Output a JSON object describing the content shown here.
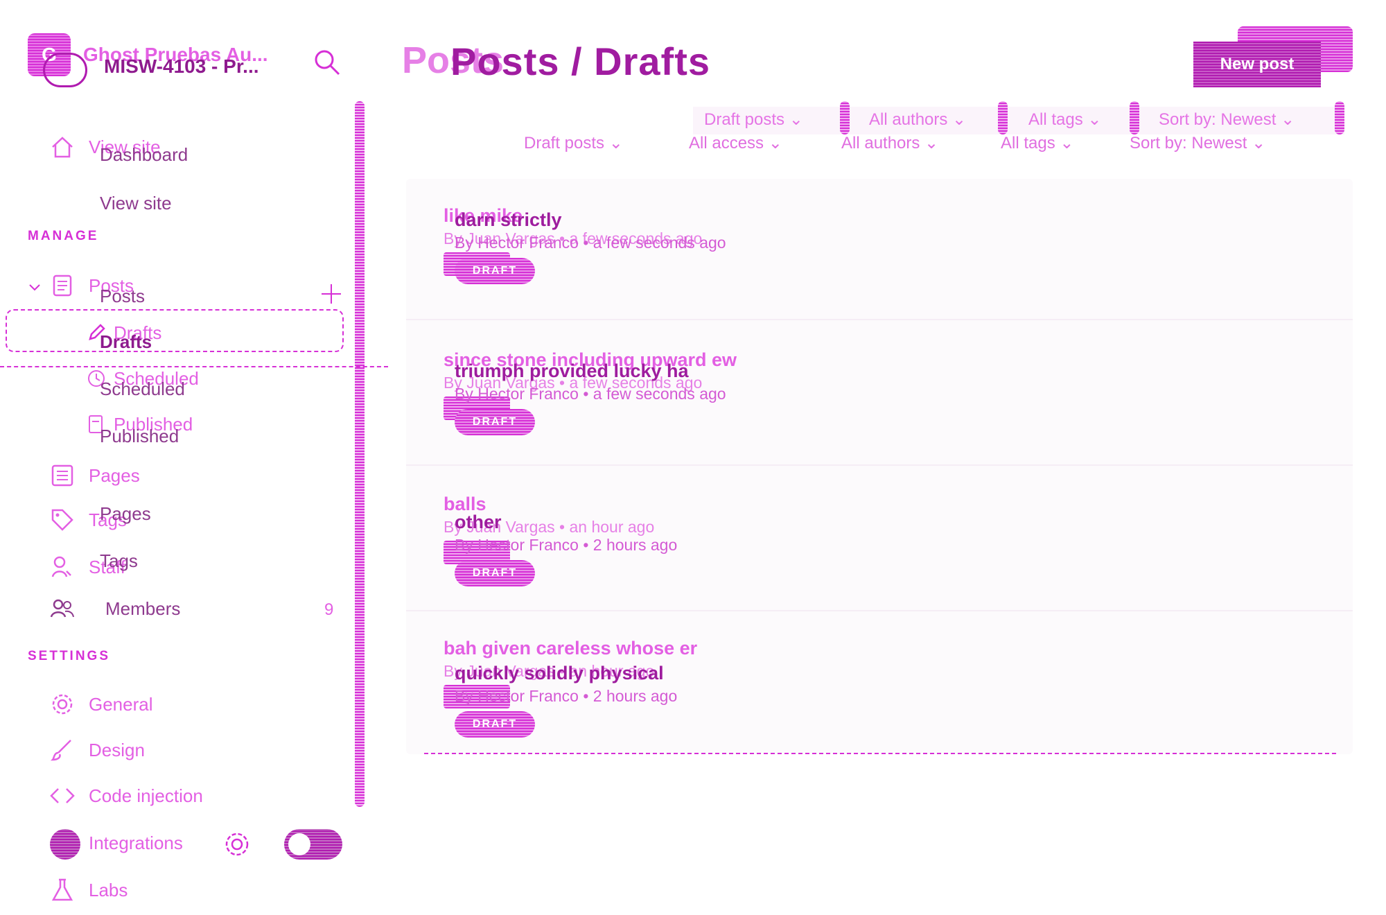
{
  "app": {
    "logo_text": "G",
    "title": "Ghost Pruebas Au...",
    "title2": "MISW-4103 - Pr..."
  },
  "sidebar": {
    "items": [
      {
        "label": "View site"
      },
      {
        "label": "Posts"
      },
      {
        "label": "Drafts"
      },
      {
        "label": "Scheduled"
      },
      {
        "label": "Published"
      },
      {
        "label": "Pages"
      },
      {
        "label": "Tags"
      },
      {
        "label": "Staff"
      },
      {
        "label": "Members",
        "count": "9"
      },
      {
        "label": "General"
      },
      {
        "label": "Design"
      },
      {
        "label": "Code injection"
      },
      {
        "label": "Integrations"
      },
      {
        "label": "Labs"
      }
    ],
    "sections": {
      "manage": "MANAGE",
      "settings": "SETTINGS"
    },
    "overlay_items": [
      {
        "label": "Dashboard"
      },
      {
        "label": "View site"
      },
      {
        "label": "Posts"
      },
      {
        "label": "Drafts"
      },
      {
        "label": "Scheduled"
      },
      {
        "label": "Published"
      },
      {
        "label": "Pages"
      },
      {
        "label": "Tags"
      }
    ]
  },
  "header": {
    "title_bg": "Posts",
    "title_fg": "Posts / Drafts",
    "new_post": "New post",
    "filters_bg": [
      "Draft posts ⌄",
      "All authors ⌄",
      "All tags ⌄",
      "Sort by: Newest ⌄"
    ],
    "filters_fg": [
      "Draft posts ⌄",
      "All access ⌄",
      "All authors ⌄",
      "All tags ⌄",
      "Sort by: Newest ⌄"
    ]
  },
  "posts_bg": [
    {
      "title": "like mike",
      "meta": "By Juan Vargas • a few seconds ago",
      "status": "DRAFT"
    },
    {
      "title": "since stone including upward ew",
      "meta": "By Juan Vargas • a few seconds ago",
      "status": "DRAFT"
    },
    {
      "title": "balls",
      "meta": "By Juan Vargas • an hour ago",
      "status": "DRAFT"
    },
    {
      "title": "bah given careless whose er",
      "meta": "By Juan Vargas • an hour ago",
      "status": "DRAFT"
    }
  ],
  "posts_fg": [
    {
      "title": "darn strictly",
      "meta": "By Hector Franco • a few seconds ago",
      "status": "DRAFT"
    },
    {
      "title": "triumph provided lucky ha",
      "meta": "By Hector Franco • a few seconds ago",
      "status": "DRAFT"
    },
    {
      "title": "other",
      "meta": "By Hector Franco • 2 hours ago",
      "status": "DRAFT"
    },
    {
      "title": "quickly solidly physical",
      "meta": "By Hector Franco • 2 hours ago",
      "status": "DRAFT"
    }
  ],
  "colors": {
    "accent": "#d62fd6",
    "accent_dark": "#a01ca0",
    "light": "#f2b6f2"
  }
}
